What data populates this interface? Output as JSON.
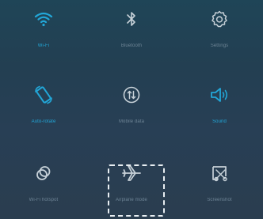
{
  "colors": {
    "active": "#22a7d8",
    "inactive": "#c7d1d8",
    "highlight": "#e8eef2"
  },
  "tiles": [
    {
      "id": "wifi",
      "label": "Wi-Fi",
      "icon": "wifi-icon",
      "active": true
    },
    {
      "id": "bluetooth",
      "label": "Bluetooth",
      "icon": "bluetooth-icon",
      "active": false
    },
    {
      "id": "settings",
      "label": "Settings",
      "icon": "gear-icon",
      "active": false
    },
    {
      "id": "auto-rotate",
      "label": "Auto-rotate",
      "icon": "rotate-icon",
      "active": true
    },
    {
      "id": "mobile-data",
      "label": "Mobile data",
      "icon": "mobile-data-icon",
      "active": false
    },
    {
      "id": "sound",
      "label": "Sound",
      "icon": "speaker-icon",
      "active": true
    },
    {
      "id": "wifi-hotspot",
      "label": "Wi-Fi hotspot",
      "icon": "hotspot-icon",
      "active": false
    },
    {
      "id": "airplane-mode",
      "label": "Airplane mode",
      "icon": "airplane-icon",
      "active": false,
      "highlighted": true
    },
    {
      "id": "screenshot",
      "label": "Screenshot",
      "icon": "screenshot-icon",
      "active": false
    }
  ]
}
